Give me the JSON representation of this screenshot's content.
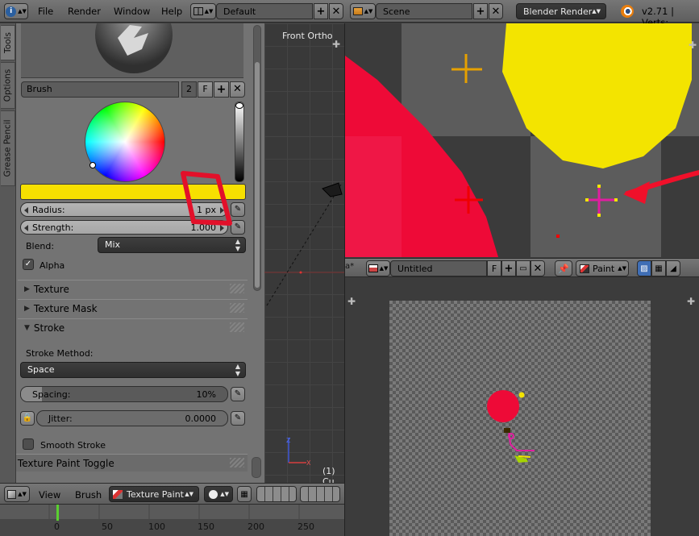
{
  "topbar": {
    "menus": [
      "File",
      "Render",
      "Window",
      "Help"
    ],
    "screen_layout": "Default",
    "scene": "Scene",
    "render_engine": "Blender Render",
    "version": "v2.71 | Verts:"
  },
  "left_tabs": [
    "Tools",
    "Options",
    "Grease Pencil"
  ],
  "brush": {
    "name": "Brush",
    "users": "2",
    "fake_user": "F"
  },
  "brush_color": "#f7e000",
  "radius": {
    "label": "Radius:",
    "value": "1 px"
  },
  "strength": {
    "label": "Strength:",
    "value": "1.000"
  },
  "blend": {
    "label": "Blend:",
    "value": "Mix"
  },
  "alpha": {
    "label": "Alpha",
    "checked": true
  },
  "panels": {
    "texture": "Texture",
    "texture_mask": "Texture Mask",
    "stroke": "Stroke",
    "texture_paint_toggle": "Texture Paint Toggle"
  },
  "stroke": {
    "method_label": "Stroke Method:",
    "method_value": "Space",
    "spacing_label": "Spacing:",
    "spacing_value": "10%",
    "spacing_fraction": 0.1,
    "jitter_label": "Jitter:",
    "jitter_value": "0.0000",
    "smooth_label": "Smooth Stroke"
  },
  "viewport": {
    "view_label": "Front Ortho",
    "object_label": "(1) Cu"
  },
  "image_editor": {
    "image_name": "Untitled",
    "fake_user": "F",
    "mode": "Paint"
  },
  "bottom_header": {
    "view": "View",
    "brush": "Brush",
    "mode": "Texture Paint"
  },
  "timeline": {
    "ticks": [
      "0",
      "50",
      "100",
      "150",
      "200",
      "250"
    ],
    "current_frame": "1"
  }
}
